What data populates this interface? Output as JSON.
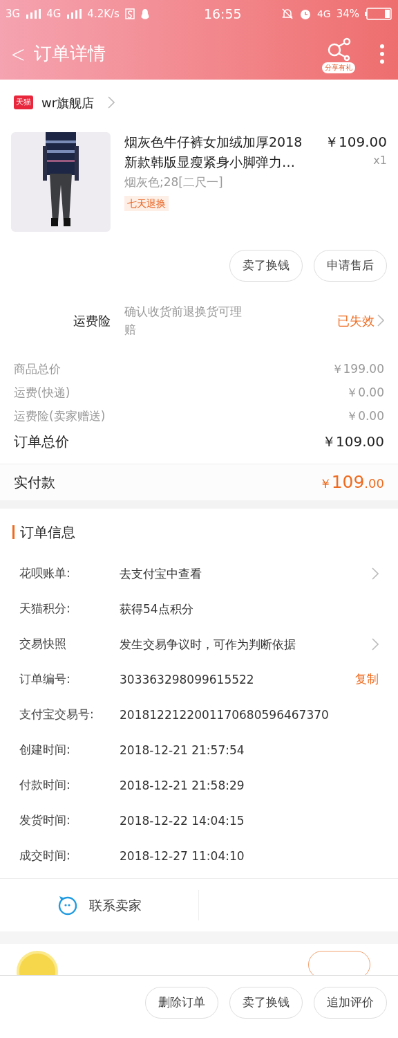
{
  "status_bar": {
    "left": [
      "3G",
      "4G"
    ],
    "speed": "4.2K/s",
    "time": "16:55",
    "network": "4G",
    "battery": "34%"
  },
  "header": {
    "back": "<",
    "title": "订单详情",
    "share_badge": "分享有礼"
  },
  "shop": {
    "badge": "天猫",
    "name": "wr旗舰店"
  },
  "product": {
    "title": "烟灰色牛仔裤女加绒加厚2018新款韩版显瘦紧身小脚弹力…",
    "price": "￥109.00",
    "quantity": "x1",
    "sku": "烟灰色;28[二尺一]",
    "tag": "七天退换"
  },
  "item_actions": [
    "卖了换钱",
    "申请售后"
  ],
  "insurance": {
    "label": "运费险",
    "description": "确认收货前退换货可理赔",
    "status": "已失效"
  },
  "price_rows": [
    {
      "label": "商品总价",
      "value": "￥199.00",
      "kind": "minor"
    },
    {
      "label": "运费(快递)",
      "value": "￥0.00",
      "kind": "minor"
    },
    {
      "label": "运费险(卖家赠送)",
      "value": "￥0.00",
      "kind": "minor"
    },
    {
      "label": "订单总价",
      "value": "￥109.00",
      "kind": "total"
    }
  ],
  "paid": {
    "label": "实付款",
    "currency": "￥",
    "integer": "109",
    "decimal": ".00"
  },
  "order_info": {
    "title": "订单信息",
    "rows": [
      {
        "kind": "link",
        "label": "花呗账单:",
        "value": "去支付宝中查看"
      },
      {
        "kind": "plain",
        "label": "天猫积分:",
        "value": "获得54点积分"
      },
      {
        "kind": "link",
        "label": "交易快照",
        "value": "发生交易争议时，可作为判断依据"
      },
      {
        "kind": "copy",
        "label": "订单编号:",
        "value": "303363298099615522",
        "action_label": "复制"
      },
      {
        "kind": "plain",
        "label": "支付宝交易号:",
        "value": "2018122122001170680596467370"
      },
      {
        "kind": "plain",
        "label": "创建时间:",
        "value": "2018-12-21 21:57:54"
      },
      {
        "kind": "plain",
        "label": "付款时间:",
        "value": "2018-12-21 21:58:29"
      },
      {
        "kind": "plain",
        "label": "发货时间:",
        "value": "2018-12-22 14:04:15"
      },
      {
        "kind": "plain",
        "label": "成交时间:",
        "value": "2018-12-27 11:04:10"
      }
    ]
  },
  "contact": "联系卖家",
  "bottom_actions": [
    "删除订单",
    "卖了换钱",
    "追加评价"
  ]
}
